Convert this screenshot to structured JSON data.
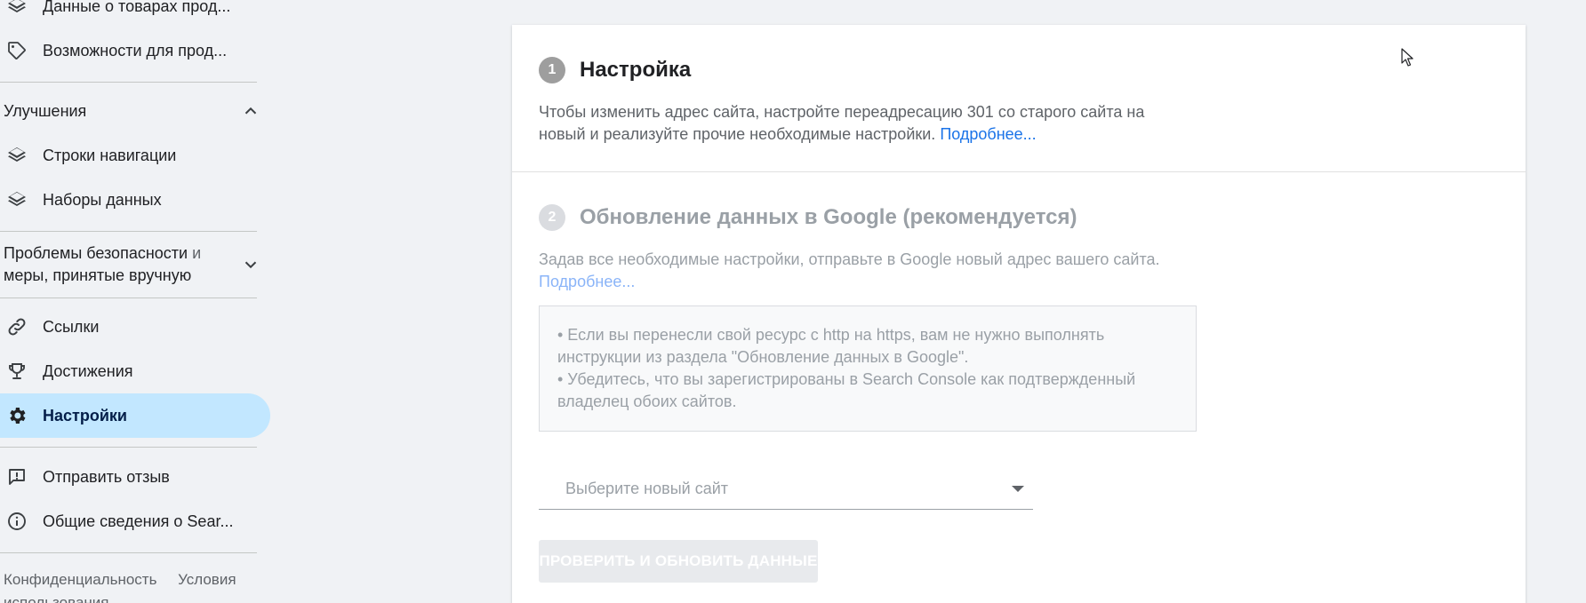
{
  "sidebar": {
    "top_items": [
      {
        "label": "Данные о товарах прод...",
        "icon": "layers-icon"
      },
      {
        "label": "Возможности для прод...",
        "icon": "tag-icon"
      }
    ],
    "enhancements": {
      "header": "Улучшения",
      "items": [
        {
          "label": "Строки навигации",
          "icon": "layers-icon"
        },
        {
          "label": "Наборы данных",
          "icon": "layers-icon"
        }
      ]
    },
    "security": {
      "line1_main": "Проблемы безопасности",
      "line1_tail": " и",
      "line2": "меры, принятые вручную"
    },
    "items": [
      {
        "label": "Ссылки",
        "icon": "link-icon"
      },
      {
        "label": "Достижения",
        "icon": "trophy-icon"
      },
      {
        "label": "Настройки",
        "icon": "gear-icon",
        "active": true
      }
    ],
    "bottom_items": [
      {
        "label": "Отправить отзыв",
        "icon": "feedback-icon"
      },
      {
        "label": "Общие сведения о Sear...",
        "icon": "info-icon"
      }
    ],
    "footer": {
      "privacy": "Конфиденциальность",
      "terms": "Условия",
      "terms_line2": "использования"
    }
  },
  "main": {
    "step1": {
      "number": "1",
      "title": "Настройка",
      "desc_line1": "Чтобы изменить адрес сайта, настройте переадресацию 301 со старого сайта на",
      "desc_line2": "новый и реализуйте прочие необходимые настройки.",
      "link": "Подробнее..."
    },
    "step2": {
      "number": "2",
      "title": "Обновление данных в Google (рекомендуется)",
      "desc_line1": "Задав все необходимые настройки, отправьте в Google новый адрес вашего сайта.",
      "link": "Подробнее..."
    },
    "notice": {
      "line1": "• Если вы перенесли свой ресурс с http на https, вам не нужно выполнять",
      "line2": "инструкции из раздела \"Обновление данных в Google\".",
      "line3": "• Убедитесь, что вы зарегистрированы в Search Console как подтвержденный",
      "line4": "владелец обоих сайтов."
    },
    "select": {
      "placeholder": "Выберите новый сайт"
    },
    "verify_button": "ПРОВЕРИТЬ И ОБНОВИТЬ ДАННЫЕ"
  },
  "colors": {
    "active_bg": "#c2e7ff",
    "link": "#1a73e8",
    "link_disabled": "#8ab4f8",
    "step_active": "#9e9e9e",
    "step_disabled": "#dadce0"
  }
}
